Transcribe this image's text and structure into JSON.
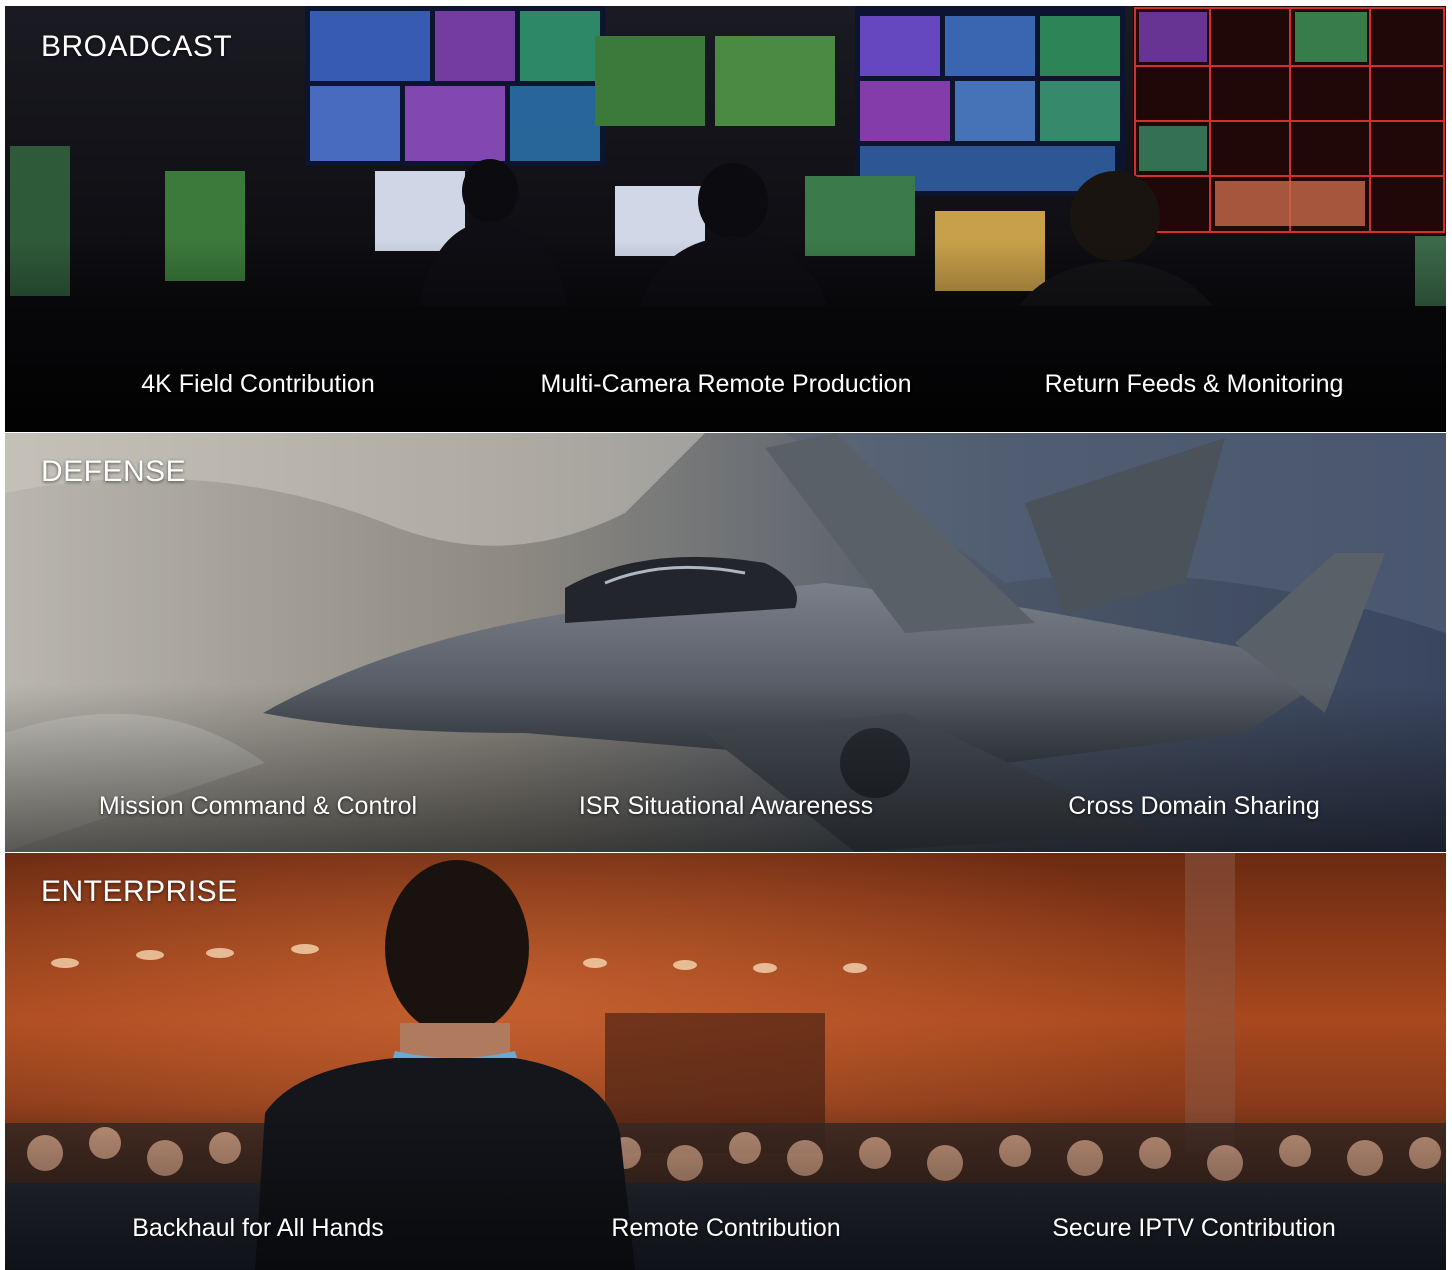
{
  "panels": [
    {
      "title": "BROADCAST",
      "links": [
        "4K Field Contribution",
        "Multi-Camera Remote Production",
        "Return Feeds & Monitoring"
      ]
    },
    {
      "title": "DEFENSE",
      "links": [
        "Mission Command & Control",
        "ISR Situational Awareness",
        "Cross Domain Sharing"
      ]
    },
    {
      "title": "ENTERPRISE",
      "links": [
        "Backhaul for All Hands",
        "Remote Contribution",
        "Secure IPTV Contribution"
      ]
    }
  ]
}
